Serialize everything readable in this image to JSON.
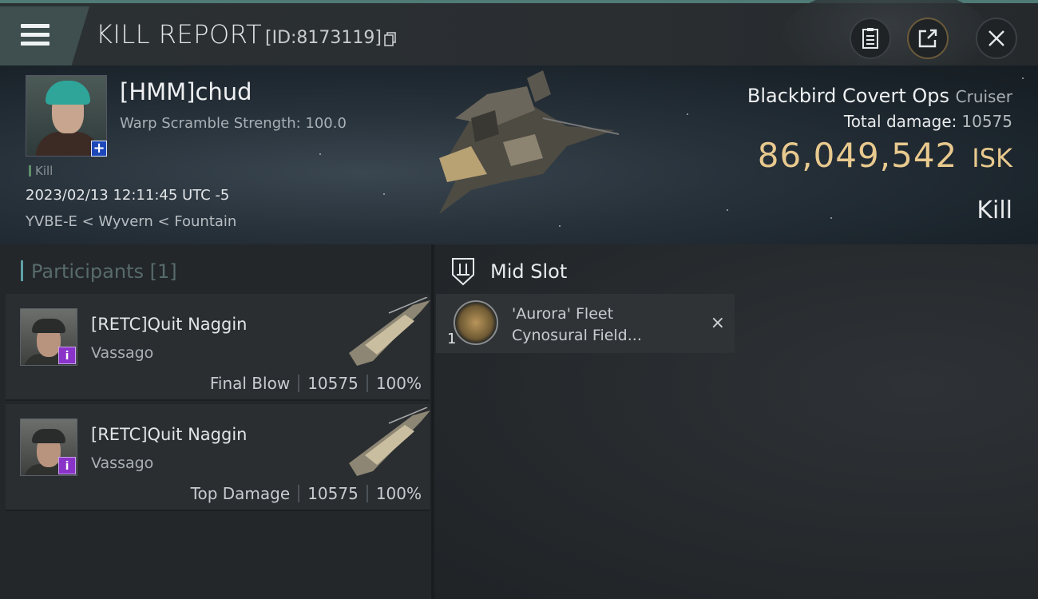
{
  "header": {
    "title": "KILL REPORT",
    "id_label": "[ID:8173119]"
  },
  "icons": {
    "menu": "hamburger-menu-icon",
    "copy": "copy-icon",
    "notes": "clipboard-icon",
    "share": "share-external-icon",
    "close": "close-icon"
  },
  "victim": {
    "name": "[HMM]chud",
    "warp_scramble": "Warp Scramble Strength: 100.0",
    "badge_plus": "+",
    "kill_tag": "Kill",
    "datetime": "2023/02/13 12:11:45 UTC -5",
    "location": "YVBE-E < Wyvern < Fountain"
  },
  "ship": {
    "name": "Blackbird Covert Ops",
    "class": "Cruiser",
    "total_damage_label": "Total damage:",
    "total_damage": "10575",
    "isk_value": "86,049,542",
    "isk_unit": "ISK",
    "result": "Kill"
  },
  "participants": {
    "title": "Participants [1]",
    "rows": [
      {
        "name": "[RETC]Quit Naggin",
        "ship": "Vassago",
        "role": "Final Blow",
        "damage": "10575",
        "percent": "100%",
        "badge": "i"
      },
      {
        "name": "[RETC]Quit Naggin",
        "ship": "Vassago",
        "role": "Top Damage",
        "damage": "10575",
        "percent": "100%",
        "badge": "i"
      }
    ]
  },
  "fitting": {
    "slot_title": "Mid Slot",
    "modules": [
      {
        "qty": "1",
        "name_line1": "'Aurora' Fleet",
        "name_line2": "Cynosural Field...",
        "status": "×"
      }
    ]
  },
  "colors": {
    "accent": "#4f7a75",
    "isk": "#e8c98e",
    "info_badge": "#8a33c9",
    "plus_badge": "#1d47b8"
  }
}
